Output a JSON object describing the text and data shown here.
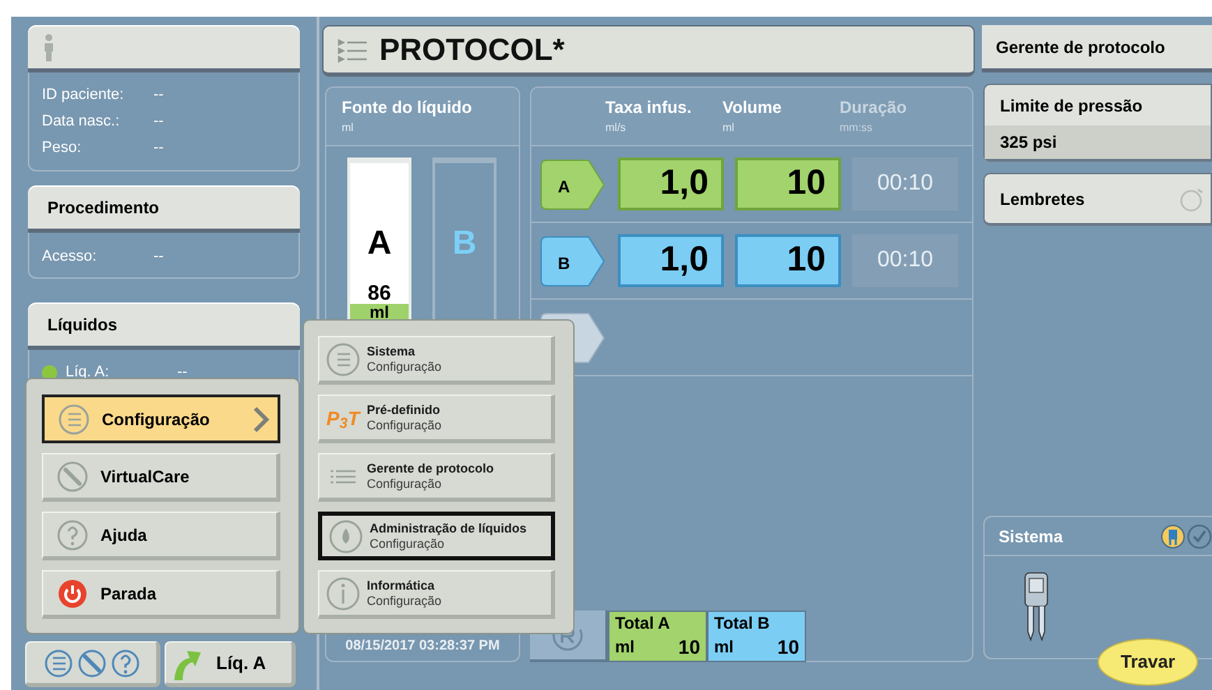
{
  "patient": {
    "fields": [
      {
        "label": "ID paciente:",
        "value": "--"
      },
      {
        "label": "Data nasc.:",
        "value": "--"
      },
      {
        "label": "Peso:",
        "value": "--"
      }
    ]
  },
  "procedure": {
    "title": "Procedimento",
    "fields": [
      {
        "label": "Acesso:",
        "value": "--"
      }
    ]
  },
  "fluids": {
    "title": "Líquidos",
    "fields": [
      {
        "label": "Líq. A:",
        "value": "--",
        "color": "#8cc63f"
      }
    ]
  },
  "protocol_header": {
    "title": "PROTOCOL*"
  },
  "source": {
    "title": "Fonte do líquido",
    "unit": "ml",
    "syringes": [
      {
        "kind": "A",
        "label": "A",
        "volume": "86",
        "unit": "ml",
        "level": 0.1
      },
      {
        "kind": "B",
        "label": "B"
      }
    ],
    "timestamp": "08/15/2017 03:28:37 PM"
  },
  "protocol": {
    "columns": [
      {
        "label": "Taxa infus.",
        "unit": "ml/s",
        "disabled": false
      },
      {
        "label": "Volume",
        "unit": "ml",
        "disabled": false
      },
      {
        "label": "Duração",
        "unit": "mm:ss",
        "disabled": true
      }
    ],
    "phases": [
      {
        "kind": "A",
        "label": "A",
        "rate": "1,0",
        "volume": "10",
        "duration": "00:10"
      },
      {
        "kind": "B",
        "label": "B",
        "rate": "1,0",
        "volume": "10",
        "duration": "00:10"
      },
      {
        "kind": "empty"
      }
    ],
    "totals": [
      {
        "kind": "A",
        "label": "Total A",
        "unit": "ml",
        "value": "10"
      },
      {
        "kind": "B",
        "label": "Total B",
        "unit": "ml",
        "value": "10"
      }
    ]
  },
  "manager_tab": {
    "label": "Gerente de protocolo"
  },
  "pressure_limit": {
    "title": "Limite de pressão",
    "value": "325 psi"
  },
  "reminders": {
    "title": "Lembretes"
  },
  "system": {
    "title": "Sistema"
  },
  "lock_button": {
    "label": "Travar"
  },
  "menu": [
    {
      "label": "Configuração",
      "selected": true,
      "submenu": true
    },
    {
      "label": "VirtualCare",
      "selected": false,
      "submenu": false
    },
    {
      "label": "Ajuda",
      "selected": false,
      "submenu": false
    },
    {
      "label": "Parada",
      "selected": false,
      "submenu": false
    }
  ],
  "submenu": [
    {
      "title": "Sistema",
      "subtitle": "Configuração",
      "selected": false
    },
    {
      "logo": "P$_{3}$T",
      "title": "Pré-definido",
      "subtitle": "Configuração",
      "selected": false
    },
    {
      "title": "Gerente de protocolo",
      "subtitle": "Configuração",
      "selected": false
    },
    {
      "title": "Administração de líquidos",
      "subtitle": "Configuração",
      "selected": true
    },
    {
      "title": "Informática",
      "subtitle": "Configuração",
      "selected": false
    }
  ],
  "fluid_button": {
    "label": "Líq. A"
  }
}
